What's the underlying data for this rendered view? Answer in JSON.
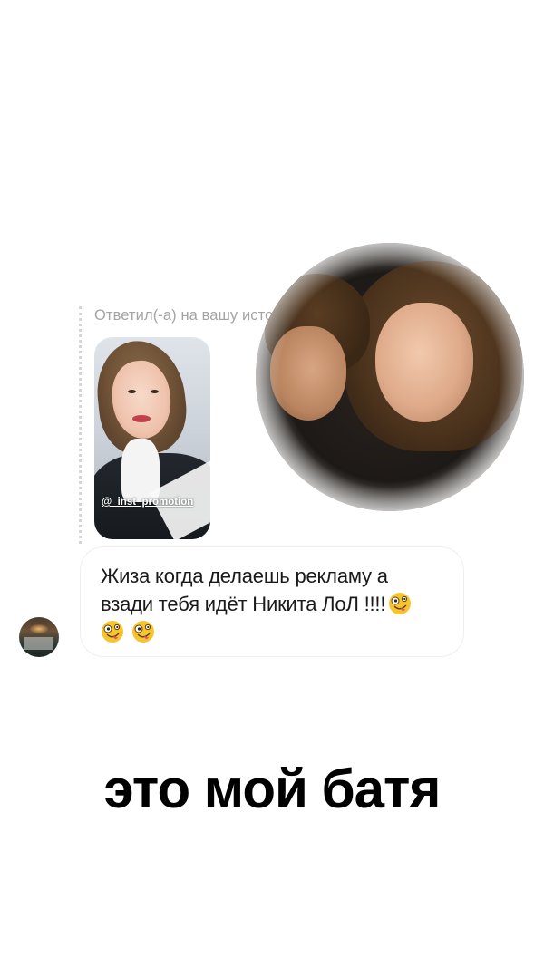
{
  "reply": {
    "caption": "Ответил(-а) на вашу историю"
  },
  "story": {
    "mention": "@_inst_promotion"
  },
  "message": {
    "line1": "Жиза когда делаешь рекламу а",
    "line2": "взади тебя идёт Никита ЛоЛ !!!!",
    "emoji_name": "zany-face-emoji"
  },
  "overlay_caption": "это мой батя"
}
